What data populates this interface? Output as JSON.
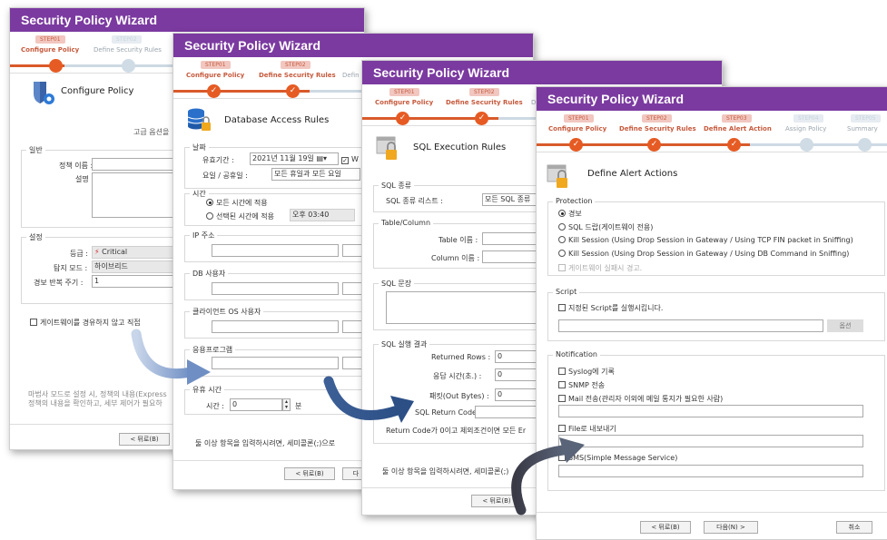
{
  "wizard_title": "Security Policy Wizard",
  "step_badges": [
    "STEP01",
    "STEP02",
    "STEP03",
    "STEP04",
    "STEP05"
  ],
  "step_labels": [
    "Configure Policy",
    "Define Security Rules",
    "Define Alert Action",
    "Assign Policy",
    "Summary"
  ],
  "step_labels_partial": {
    "w1_step2": "Define Security Rules",
    "w2_step3": "Defin",
    "w3_step3": "D"
  },
  "checkmark": "✓",
  "w1": {
    "title": "Configure Policy",
    "advanced": "고급 옵션을",
    "general": {
      "title": "일반",
      "policy_name_label": "정책 이름 :",
      "desc_label": "설명 :"
    },
    "settings": {
      "title": "설정",
      "level_label": "등급 :",
      "level_value": "Critical",
      "detect_label": "탐지 모드 :",
      "detect_value": "하이브리드",
      "repeat_label": "경보 반복 주기 :",
      "repeat_value": "1"
    },
    "bypass_label": "게이트웨이를 경유하지 않고 직접",
    "note_line1": "마법사 모드로 설정 시, 정책의 내용(Express",
    "note_line2": "정책의 내용을 확인하고, 세부 제어가 필요하",
    "back_btn": "< 뒤로(B)"
  },
  "w2": {
    "title": "Database Access Rules",
    "date": {
      "title": "날짜",
      "validity_label": "유효기간 :",
      "validity_value": "2021년 11월 19일",
      "day_label": "요일 / 공휴일 :",
      "day_value": "모든 휴일과 모든 요일"
    },
    "time": {
      "title": "시간",
      "opt_all": "모든 시간에 적용",
      "opt_sel": "선택된 시간에 적용",
      "time_value": "오후 03:40"
    },
    "ip_title": "IP 주소",
    "db_user_title": "DB 사용자",
    "client_os_title": "클라이언트 OS 사용자",
    "app_title": "응용프로그램",
    "hold": {
      "title": "유휴 시간",
      "time_label": "시간 :",
      "time_value": "0",
      "unit": "분"
    },
    "hint": "둘 이상 항목을 입력하시려면, 세미콜론(;)으로",
    "back_btn": "< 뒤로(B)",
    "next_partial": "다"
  },
  "w3": {
    "title": "SQL Execution Rules",
    "sql_type": {
      "title": "SQL 종류",
      "list_label": "SQL 종류 리스트 :",
      "list_value": "모든 SQL 종류"
    },
    "table_col": {
      "title": "Table/Column",
      "table_label": "Table 이름 :",
      "col_label": "Column 이름 :"
    },
    "sql_stmt_title": "SQL 문장",
    "result": {
      "title": "SQL 실행 결과",
      "rows_label": "Returned Rows :",
      "rows_value": "0",
      "resp_label": "응답 시간(초.) :",
      "resp_value": "0",
      "bytes_label": "패킷(Out Bytes) :",
      "bytes_value": "0",
      "code_label": "SQL Return Code :",
      "code_note": "Return Code가 0이고 제외조건이면 모든 Er"
    },
    "hint": "둘 이상 항목을 입력하시려면, 세미콜론(;)",
    "back_btn": "< 뒤로(B)"
  },
  "w4": {
    "title": "Define Alert Actions",
    "protection": {
      "title": "Protection",
      "opt1": "경보",
      "opt2": "SQL 드랍(게이트웨이 전용)",
      "opt3": "Kill Session (Using Drop Session in Gateway / Using TCP FIN packet in Sniffing)",
      "opt4": "Kill Session (Using Drop Session in Gateway / Using DB Command in Sniffing)",
      "opt5": "게이트웨이 실패시 경고."
    },
    "script": {
      "title": "Script",
      "run_label": "지정된 Script를 실행시킵니다.",
      "option_btn": "옵션"
    },
    "notification": {
      "title": "Notification",
      "syslog": "Syslog에 기록",
      "snmp": "SNMP 전송",
      "mail": "Mail 전송(관리자 이외에 메일 통지가 필요한 사람)",
      "file": "File로 내보내기",
      "sms": "SMS(Simple Message Service)"
    },
    "back_btn": "< 뒤로(B)",
    "next_btn": "다음(N) >",
    "cancel_btn": "취소"
  },
  "colors": {
    "title_bar": "#7b3aa0",
    "step_active": "#e65b23",
    "step_inactive": "#cfdbe5",
    "arrow": "#4a6fa5"
  }
}
